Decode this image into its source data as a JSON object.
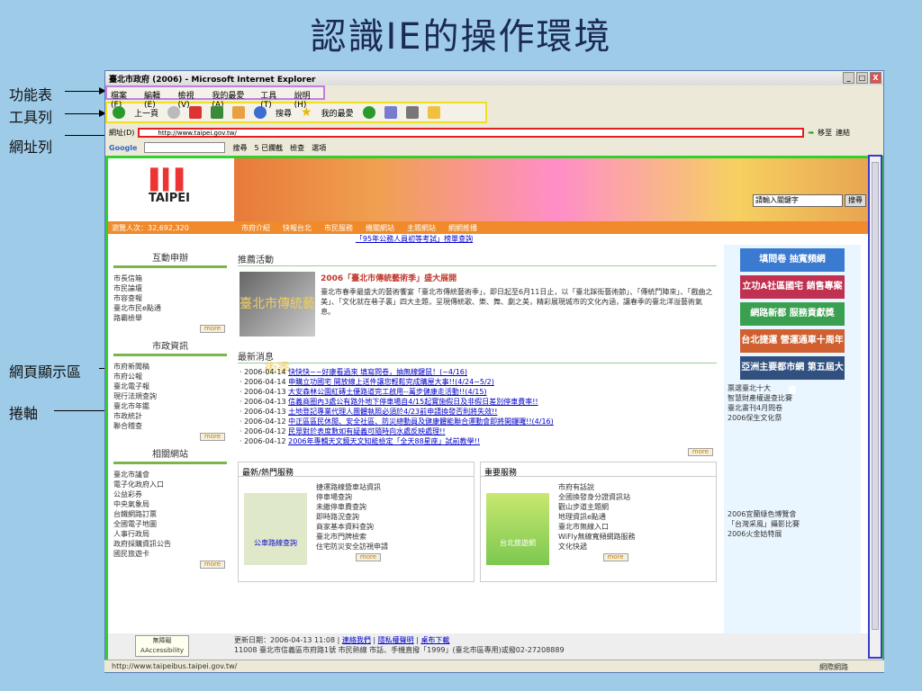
{
  "slide_title": "認識IE的操作環境",
  "labels": {
    "menubar": "功能表",
    "toolbar": "工具列",
    "addressbar": "網址列",
    "viewport": "網頁顯示區",
    "scrollbar": "捲軸"
  },
  "window": {
    "title": "臺北市政府 (2006) - Microsoft Internet Explorer",
    "minimize": "_",
    "maximize": "□",
    "close": "X"
  },
  "menu": [
    "檔案(F)",
    "編輯(E)",
    "檢視(V)",
    "我的最愛(A)",
    "工具(T)",
    "說明(H)"
  ],
  "toolbar": {
    "back": "上一頁",
    "search": "搜尋",
    "favorites": "我的最愛"
  },
  "address": {
    "label": "網址(D)",
    "url": "http://www.taipei.gov.tw/",
    "go": "移至",
    "links": "連結"
  },
  "google": {
    "brand": "Google",
    "search": "搜尋",
    "blocked": "5 已攔截",
    "check": "檢查",
    "options": "選項"
  },
  "page": {
    "logo_text": "TAIPEI",
    "search_placeholder": "請輸入關鍵字",
    "search_button": "搜尋",
    "visitors": "瀏覽人次：32,692,320",
    "nav": [
      "市府介紹",
      "快報台北",
      "市民服務",
      "機關網站",
      "主題網站",
      "網網推播"
    ],
    "exam_link": "「95年公務人員初等考試」榜單查詢",
    "sections": {
      "interactive": {
        "title": "互動申辦",
        "items": [
          "市長信箱",
          "市民論壇",
          "市容查報",
          "臺北市民e點通",
          "路霸檢舉"
        ]
      },
      "municipal": {
        "title": "市政資訊",
        "items": [
          "市府新聞稿",
          "市府公報",
          "臺北電子報",
          "現行法規查詢",
          "臺北市年鑑",
          "市政統計",
          "聯合稽查"
        ]
      },
      "related": {
        "title": "相關網站",
        "items": [
          "臺北市議會",
          "電子化政府入口",
          "公益彩券",
          "中央氣象局",
          "台鐵網路訂票",
          "全國電子地圖",
          "人事行政局",
          "政府採購資訊公告",
          "國民旅遊卡"
        ]
      },
      "more": "more"
    },
    "promo": {
      "heading": "推薦活動",
      "image_text": "臺北市傳統藝術季",
      "title": "2006「臺北市傳統藝術季」盛大展開",
      "text": "臺北市春季最盛大的藝術饗宴「臺北市傳統藝術季」，即日起至6月11日止，以「臺北踩街藝術節」、「傳統鬥陣來」、「戲曲之美」、「文化就在巷子裏」四大主題，呈現傳統歌、樂、舞、劇之美，精彩展現城市的文化內涵，讓春季的臺北洋溢藝術氣息。"
    },
    "news": {
      "heading": "最新消息",
      "items": [
        {
          "date": "2006-04-14",
          "text": "快快快~~好康看過來 填寫問卷，抽無線鍵鼠！(~4/16)"
        },
        {
          "date": "2006-04-14",
          "text": "申購立功國宅 開放線上送件讓您輕鬆完成購屋大事!!(4/24~5/2)"
        },
        {
          "date": "2006-04-13",
          "text": "大安森林公園紅磚土優路道完工啟用--萬步健康走活動!!(4/15)"
        },
        {
          "date": "2006-04-13",
          "text": "信義商圈內3處公有路外地下停車場自4/15起實施假日及非假日差別停車費率!!"
        },
        {
          "date": "2006-04-13",
          "text": "土地登記專業代理人團體執照必須於4/23前申請換發否則將失效!!"
        },
        {
          "date": "2006-04-12",
          "text": "中正區區民休閒、安全社區、防災總動員及健康體能聯合運動會即將開鑼囉!!(4/16)"
        },
        {
          "date": "2006-04-12",
          "text": "民眾對於表度數如有疑義可隨時向水處反映處理!!"
        },
        {
          "date": "2006-04-12",
          "text": "2006年專輯天文鏡天文知能檢定「全天88星座」試前教學!!"
        }
      ]
    },
    "services": {
      "hot_heading": "最新/熱門服務",
      "hot_img": "公車路線查詢",
      "hot_items": [
        "捷運路線暨車站資訊",
        "停車場查詢",
        "未繳停車費查詢",
        "即時路況查詢",
        "商家基本資料查詢",
        "臺北市門牌檢索",
        "住宅防災安全訪視申請"
      ],
      "important_heading": "重要服務",
      "important_img": "台北旅遊網",
      "important_items": [
        "市府有話說",
        "全國換發身分證資訊站",
        "觀山步道主題網",
        "地理資訊e點通",
        "臺北市無線入口",
        "WiFly無線寬頻網路服務",
        "文化快遞"
      ]
    },
    "ads": [
      "填問卷 抽寬頻網",
      "立功A社區國宅 銷售專案",
      "網路新都 服務貢獻獎",
      "台北捷運 營運通車十周年",
      "亞洲主要都市網 第五屆大會"
    ],
    "ad_links": [
      "票選臺北十大",
      "智慧財產權邊查比賽",
      "臺北畫刊4月問卷",
      "2006保生文化祭"
    ],
    "ad_links2": [
      "2006宜蘭綠色博覽會",
      "「台灣采風」攝影比賽",
      "2006火金姑特展"
    ],
    "footer": {
      "updated": "更新日期：2006-04-13 11:08",
      "contact": "連絡我們",
      "privacy": "隱私權聲明",
      "download": "桌布下載",
      "address": "11008 臺北市信義區市府路1號 市民熱線 市話、手機直撥「1999」(臺北市區專用)或撥02-27208889",
      "badge": "無障礙 AAccessibility"
    }
  },
  "status": {
    "url": "http://www.taipeibus.taipei.gov.tw/",
    "zone": "網際網路"
  }
}
